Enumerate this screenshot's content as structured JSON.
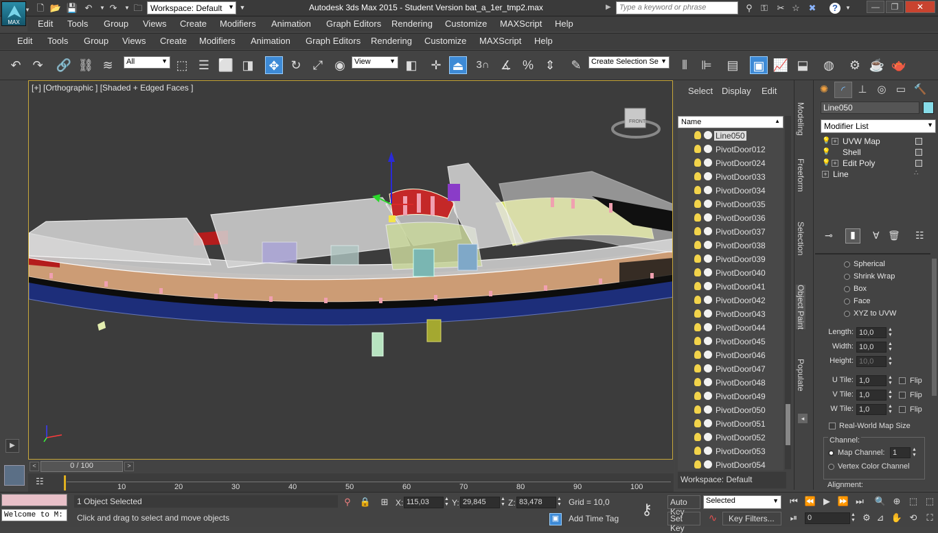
{
  "app": {
    "logo_text": "MAX",
    "workspace_label": "Workspace: Default",
    "title": "Autodesk 3ds Max  2015   - Student Version     bat_a_1er_tmp2.max",
    "search_placeholder": "Type a keyword or phrase",
    "minimize": "—",
    "restore": "❐",
    "close": "✕",
    "help_icon": "?"
  },
  "menu1": [
    "Edit",
    "Tools",
    "Group",
    "Views",
    "Create",
    "Modifiers",
    "Animation",
    "Graph Editors",
    "Rendering",
    "Customize",
    "MAXScript",
    "Help"
  ],
  "menu2": [
    "Edit",
    "Tools",
    "Group",
    "Views",
    "Create",
    "Modifiers",
    "Animation",
    "Graph Editors",
    "Rendering",
    "Customize",
    "MAXScript",
    "Help"
  ],
  "toolbar": {
    "filter_value": "All",
    "refcoord_value": "View",
    "selection_set_value": "Create Selection Se",
    "snap_label": "3"
  },
  "viewport": {
    "label": "[+] [Orthographic ] [Shaded + Edged Faces ]",
    "viewcube_label": "FRONT"
  },
  "explorer": {
    "tabs": [
      "Select",
      "Display",
      "Edit"
    ],
    "column_header": "Name",
    "objects": [
      "Line050",
      "PivotDoor012",
      "PivotDoor024",
      "PivotDoor033",
      "PivotDoor034",
      "PivotDoor035",
      "PivotDoor036",
      "PivotDoor037",
      "PivotDoor038",
      "PivotDoor039",
      "PivotDoor040",
      "PivotDoor041",
      "PivotDoor042",
      "PivotDoor043",
      "PivotDoor044",
      "PivotDoor045",
      "PivotDoor046",
      "PivotDoor047",
      "PivotDoor048",
      "PivotDoor049",
      "PivotDoor050",
      "PivotDoor051",
      "PivotDoor052",
      "PivotDoor053",
      "PivotDoor054"
    ],
    "selected": "Line050",
    "footer": "Workspace: Default"
  },
  "ribbon_tabs": [
    "Modeling",
    "Freeform",
    "Selection",
    "Object Paint",
    "Populate"
  ],
  "command_panel": {
    "object_name": "Line050",
    "object_color": "#87dce8",
    "modifier_list": "Modifier List",
    "stack": [
      {
        "name": "UVW Map",
        "expandable": true
      },
      {
        "name": "Shell",
        "expandable": false
      },
      {
        "name": "Edit Poly",
        "expandable": true
      },
      {
        "name": "Line",
        "expandable": true
      }
    ],
    "mapping_options": [
      "Spherical",
      "Shrink Wrap",
      "Box",
      "Face",
      "XYZ to UVW"
    ],
    "length_label": "Length:",
    "length_value": "10,0",
    "width_label": "Width:",
    "width_value": "10,0",
    "height_label": "Height:",
    "height_value": "10,0",
    "utile_label": "U Tile:",
    "utile_value": "1,0",
    "vtile_label": "V Tile:",
    "vtile_value": "1,0",
    "wtile_label": "W Tile:",
    "wtile_value": "1,0",
    "flip_label": "Flip",
    "realworld_label": "Real-World Map Size",
    "channel_group": "Channel:",
    "map_channel_label": "Map Channel:",
    "map_channel_value": "1",
    "vertex_color_label": "Vertex Color Channel",
    "alignment_label": "Alignment:"
  },
  "timeline": {
    "frame_display": "0 / 100",
    "ticks": [
      "10",
      "20",
      "30",
      "40",
      "50",
      "60",
      "70",
      "80",
      "90",
      "100"
    ]
  },
  "status": {
    "maxscript_text": "Welcome to M:",
    "selection_text": "1 Object Selected",
    "prompt_text": "Click and drag to select and move objects",
    "x_label": "X:",
    "x_value": "115,03",
    "y_label": "Y:",
    "y_value": "29,845",
    "z_label": "Z:",
    "z_value": "83,478",
    "grid_text": "Grid = 10,0",
    "add_time_tag": "Add Time Tag",
    "auto_key": "Auto Key",
    "set_key": "Set Key",
    "selected_value": "Selected",
    "key_filters": "Key Filters...",
    "frame_value": "0"
  }
}
